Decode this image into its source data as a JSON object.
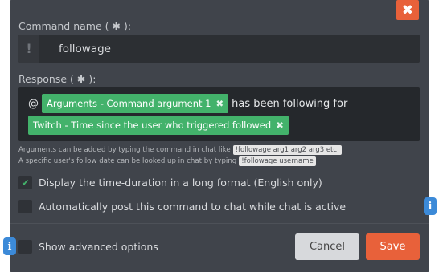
{
  "dialog": {
    "close_icon": "close-icon",
    "close_symbol": "✖"
  },
  "command_name": {
    "label": "Command name (",
    "required_symbol": "✱",
    "label_end": "):",
    "icon": "exclamation-icon",
    "icon_symbol": "!",
    "value": "followage"
  },
  "response": {
    "label": "Response (",
    "required_symbol": "✱",
    "label_end": "):",
    "prefix": "@",
    "tag1": "Arguments - Command argument 1",
    "middle_text": "has been following for",
    "tag2": "Twitch - Time since the user who triggered followed",
    "tag_remove_symbol": "✖",
    "tag_color": "#43b26b"
  },
  "help": {
    "line1_text": "Arguments can be added by typing the command in chat like",
    "line1_code": "!followage arg1 arg2 arg3 etc.",
    "line2_text": "A specific user's follow date can be looked up in chat by typing",
    "line2_code": "!followage username"
  },
  "options": {
    "long_format_label": "Display the time-duration in a long format (English only)",
    "long_format_checked": true,
    "auto_post_label": "Automatically post this command to chat while chat is active",
    "auto_post_checked": false,
    "advanced_label": "Show advanced options",
    "advanced_checked": false,
    "check_symbol": "✔"
  },
  "buttons": {
    "cancel": "Cancel",
    "save": "Save"
  },
  "info_symbol": "i",
  "colors": {
    "accent": "#e8613a",
    "modal_bg": "#40444b",
    "info": "#3c8ad8"
  }
}
